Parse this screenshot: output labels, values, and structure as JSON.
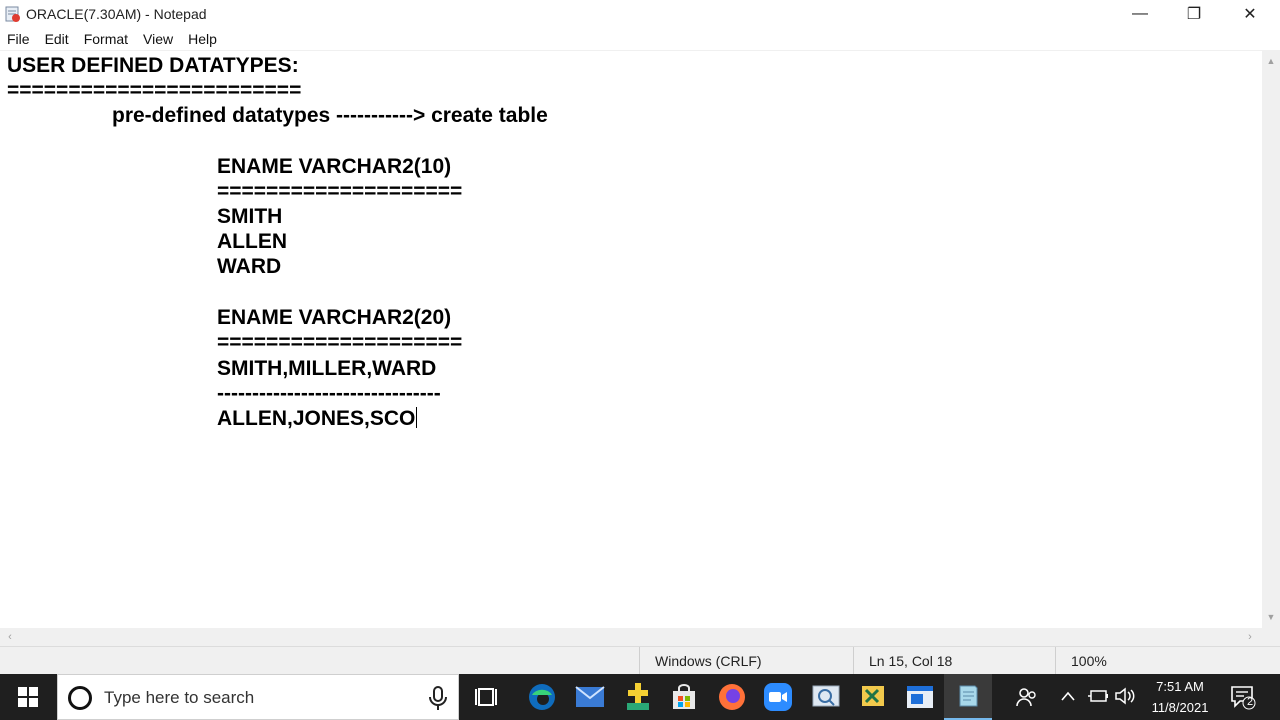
{
  "window": {
    "title": "ORACLE(7.30AM) - Notepad",
    "minimize_glyph": "—",
    "maximize_glyph": "❐",
    "close_glyph": "✕"
  },
  "menu": [
    "File",
    "Edit",
    "Format",
    "View",
    "Help"
  ],
  "editor_lines": [
    "USER DEFINED DATATYPES:",
    "========================",
    "pre-defined datatypes -----------> create table",
    "ENAME VARCHAR2(10)",
    "====================",
    "SMITH",
    "ALLEN",
    "WARD",
    "ENAME VARCHAR2(20)",
    "====================",
    "SMITH,MILLER,WARD",
    "--------------------------------",
    "ALLEN,JONES,SCO"
  ],
  "status": {
    "line_ending": "Windows (CRLF)",
    "position": "Ln 15, Col 18",
    "zoom": "100%"
  },
  "taskbar": {
    "search_placeholder": "Type here to search",
    "time": "7:51 AM",
    "date": "11/8/2021",
    "notification_count": "2"
  },
  "colors": {
    "taskbar_bg": "#1f1f1f",
    "accent": "#76b9ed",
    "edge_blue": "#0f6cbd",
    "zoom_blue": "#2d8cff",
    "firefox_orange": "#ff7139"
  }
}
